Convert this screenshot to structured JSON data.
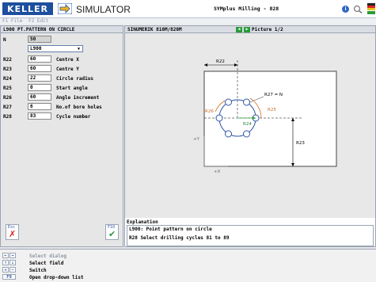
{
  "header": {
    "logo_text": "KELLER",
    "app_title": "SIMULATOR",
    "window_title": "SYMplus Milling - 828"
  },
  "menu": {
    "items": [
      "F1 File",
      "F2 Edit"
    ]
  },
  "left_panel": {
    "title": "L900 PT.PATTERN ON CIRCLE",
    "n_label": "N",
    "n_value": "50",
    "cycle_select": "L900",
    "params": [
      {
        "name": "R22",
        "value": "60",
        "desc": "Centre X"
      },
      {
        "name": "R23",
        "value": "60",
        "desc": "Centre Y"
      },
      {
        "name": "R24",
        "value": "22",
        "desc": "Circle radius"
      },
      {
        "name": "R25",
        "value": "0",
        "desc": "Start angle"
      },
      {
        "name": "R26",
        "value": "60",
        "desc": "Angle increment"
      },
      {
        "name": "R27",
        "value": "6",
        "desc": "No.of bore holes"
      },
      {
        "name": "R28",
        "value": "83",
        "desc": "Cycle number"
      }
    ],
    "esc_label": "Esc",
    "f10_label": "F10"
  },
  "right_panel": {
    "header": "SINUMERIK 810M/820M",
    "picture_label": "Picture 1/2",
    "diagram_labels": {
      "r22": "R22",
      "r23": "R23",
      "r27": "R27 = N",
      "r25": "R25",
      "r26": "R26",
      "r24": "R24",
      "plus_y": "+Y",
      "plus_x": "+X"
    },
    "explanation_title": "Explanation",
    "explanation_lines": [
      "L900: Point pattern on circle",
      "R28 Select drilling cycles 81 to 89"
    ]
  },
  "footer": {
    "hints": [
      {
        "keys": [
          "←",
          "→"
        ],
        "text": "Select dialog"
      },
      {
        "keys": [
          "↑",
          "↓"
        ],
        "text": "Select field"
      },
      {
        "keys": [
          "+",
          "−"
        ],
        "text": "Switch"
      },
      {
        "keys": [
          "F9"
        ],
        "text": "Open drop-down list"
      }
    ]
  }
}
